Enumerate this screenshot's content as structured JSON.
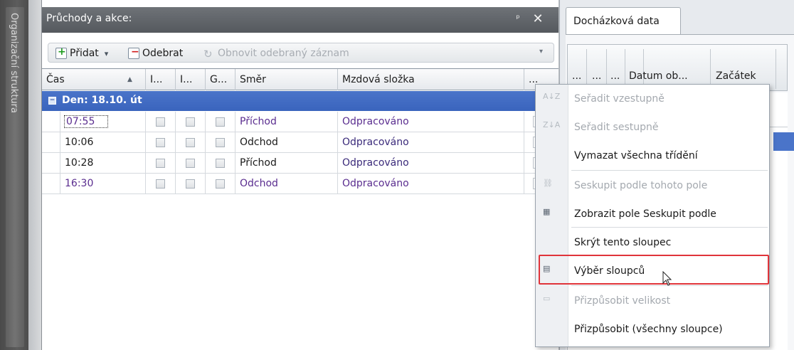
{
  "left_strip": {
    "vertical_tab_label": "Organizační struktura"
  },
  "main_panel": {
    "title": "Průchody a akce:",
    "pin_glyph": "ᵖ",
    "close_glyph": "✕"
  },
  "toolbar": {
    "add_label": "Přidat",
    "add_dropdown_glyph": "▾",
    "remove_label": "Odebrat",
    "restore_label": "Obnovit odebraný záznam",
    "chevron_glyph": "▾"
  },
  "grid": {
    "columns": [
      "Čas",
      "I...",
      "I...",
      "G...",
      "Směr",
      "Mzdová složka",
      "..."
    ],
    "sort_glyph": "▲",
    "group": {
      "toggle_glyph": "−",
      "label": "Den: 18.10. út"
    },
    "rows": [
      {
        "time": "07:55",
        "direction": "Příchod",
        "wage": "Odpracováno",
        "purple": true
      },
      {
        "time": "10:06",
        "direction": "Odchod",
        "wage": "Odpracováno",
        "purple": false
      },
      {
        "time": "10:28",
        "direction": "Příchod",
        "wage": "Odpracováno",
        "purple": false
      },
      {
        "time": "16:30",
        "direction": "Odchod",
        "wage": "Odpracováno",
        "purple": true
      }
    ]
  },
  "right_panel": {
    "tab_label": "Docházková data",
    "headers": [
      "...",
      "...",
      "...",
      "Datum ob...",
      "Začátek"
    ]
  },
  "context_menu": {
    "items": [
      {
        "label": "Seřadit vzestupně",
        "icon": "sort-asc-icon",
        "glyph": "A↓Z",
        "disabled": true
      },
      {
        "label": "Seřadit sestupně",
        "icon": "sort-desc-icon",
        "glyph": "Z↓A",
        "disabled": true
      },
      {
        "label": "Vymazat všechna třídění",
        "icon": "",
        "glyph": "",
        "disabled": false
      },
      {
        "label": "Seskupit podle tohoto pole",
        "icon": "group-by-icon",
        "glyph": "⛓",
        "disabled": true
      },
      {
        "label": "Zobrazit pole Seskupit podle",
        "icon": "group-panel-icon",
        "glyph": "▦",
        "disabled": false
      },
      {
        "label": "Skrýt tento sloupec",
        "icon": "",
        "glyph": "",
        "disabled": false
      },
      {
        "label": "Výběr sloupců",
        "icon": "column-chooser-icon",
        "glyph": "▤",
        "disabled": false,
        "highlighted": true
      },
      {
        "label": "Přizpůsobit velikost",
        "icon": "best-fit-icon",
        "glyph": "▭",
        "disabled": true
      },
      {
        "label": "Přizpůsobit (všechny sloupce)",
        "icon": "",
        "glyph": "",
        "disabled": false
      }
    ]
  },
  "colors": {
    "group_row": "#4a74c9",
    "purple_text": "#5a2d8f",
    "highlight_border": "#e0343a",
    "title_bar": "#5f6368"
  }
}
